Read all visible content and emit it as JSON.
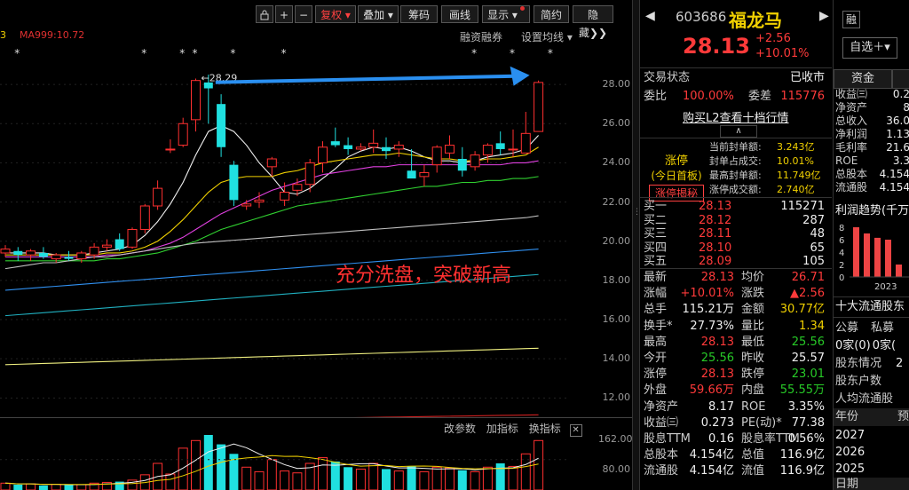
{
  "toolbar": {
    "ma_prefix": "3",
    "ma_label": "MA999:10.72",
    "buttons": {
      "fuquan": "复权",
      "diejia": "叠加",
      "choumao": "筹码",
      "huaxian": "画线",
      "xianshi": "显示",
      "jianyue": "简约",
      "yincang": "隐藏"
    },
    "rongzi": "融资融券",
    "junxian": "设置均线"
  },
  "chart_data": {
    "type": "candlestick",
    "ylim": [
      11.2,
      29.5
    ],
    "yticks": [
      "28.00",
      "26.00",
      "24.00",
      "22.00",
      "20.00",
      "18.00",
      "16.00",
      "14.00",
      "12.00"
    ],
    "candles": [
      [
        19.4,
        19.8,
        19.2,
        19.6
      ],
      [
        19.5,
        19.7,
        19.0,
        19.3
      ],
      [
        19.3,
        19.6,
        19.0,
        19.5
      ],
      [
        19.4,
        19.7,
        19.1,
        19.2
      ],
      [
        19.1,
        19.4,
        18.9,
        19.3
      ],
      [
        19.2,
        19.5,
        19.0,
        19.1
      ],
      [
        19.1,
        19.5,
        18.9,
        19.4
      ],
      [
        19.3,
        19.9,
        19.1,
        19.7
      ],
      [
        19.7,
        20.1,
        19.5,
        19.8
      ],
      [
        20.1,
        20.4,
        19.5,
        19.6
      ],
      [
        19.7,
        20.7,
        19.6,
        20.6
      ],
      [
        20.6,
        21.9,
        20.4,
        21.8
      ],
      [
        21.8,
        23.1,
        21.6,
        22.7
      ],
      [
        24.7,
        25.2,
        24.5,
        24.7
      ],
      [
        24.9,
        26.3,
        24.8,
        26.0
      ],
      [
        26.2,
        28.3,
        25.6,
        28.2
      ],
      [
        28.1,
        28.5,
        26.0,
        27.8
      ],
      [
        27.0,
        27.5,
        24.3,
        24.8
      ],
      [
        23.9,
        24.1,
        21.8,
        22.1
      ],
      [
        21.8,
        22.1,
        21.6,
        21.9
      ],
      [
        22.0,
        22.5,
        21.7,
        22.1
      ],
      [
        23.8,
        24.3,
        23.3,
        24.2
      ],
      [
        22.1,
        23.0,
        21.8,
        22.5
      ],
      [
        22.6,
        23.2,
        22.3,
        22.9
      ],
      [
        22.9,
        24.2,
        22.5,
        24.0
      ],
      [
        24.0,
        25.1,
        23.5,
        24.8
      ],
      [
        25.1,
        25.8,
        24.8,
        24.9
      ],
      [
        24.9,
        25.3,
        24.4,
        24.7
      ],
      [
        24.7,
        25.0,
        24.6,
        24.8
      ],
      [
        24.8,
        25.7,
        24.5,
        25.0
      ],
      [
        24.8,
        25.3,
        24.2,
        24.6
      ],
      [
        24.7,
        25.1,
        24.3,
        24.9
      ],
      [
        23.6,
        24.7,
        23.3,
        23.2
      ],
      [
        23.3,
        23.9,
        22.8,
        23.5
      ],
      [
        23.9,
        24.9,
        23.5,
        24.8
      ],
      [
        24.5,
        25.4,
        24.2,
        24.9
      ],
      [
        24.2,
        24.8,
        23.3,
        23.6
      ],
      [
        23.8,
        24.6,
        23.6,
        24.4
      ],
      [
        24.4,
        25.0,
        24.0,
        24.9
      ],
      [
        25.0,
        25.6,
        24.4,
        24.7
      ],
      [
        24.7,
        25.7,
        24.3,
        24.7
      ],
      [
        24.5,
        26.6,
        24.5,
        25.5
      ],
      [
        25.6,
        28.2,
        25.6,
        28.1
      ]
    ],
    "ma_series": [
      {
        "color": "#f0f0f0",
        "values": [
          19.4,
          19.4,
          19.4,
          19.4,
          19.3,
          19.3,
          19.3,
          19.4,
          19.5,
          19.6,
          19.8,
          20.3,
          21.0,
          21.9,
          23.0,
          24.4,
          25.6,
          25.9,
          25.6,
          24.9,
          24.0,
          23.3,
          22.5,
          22.4,
          22.7,
          23.2,
          23.7,
          24.3,
          24.6,
          24.8,
          24.7,
          24.8,
          24.6,
          24.3,
          24.1,
          24.1,
          24.0,
          24.1,
          24.3,
          24.4,
          24.5,
          24.7,
          25.4
        ]
      },
      {
        "color": "#f0d000",
        "values": [
          19.3,
          19.3,
          19.3,
          19.3,
          19.3,
          19.3,
          19.3,
          19.3,
          19.4,
          19.4,
          19.5,
          19.7,
          20.0,
          20.5,
          21.1,
          21.8,
          22.5,
          23.0,
          23.2,
          23.3,
          23.3,
          23.3,
          23.5,
          23.6,
          23.8,
          24.0,
          24.1,
          24.2,
          24.3,
          24.4,
          24.4,
          24.5,
          24.4,
          24.3,
          24.2,
          24.2,
          24.1,
          24.1,
          24.2,
          24.2,
          24.3,
          24.4,
          24.8
        ]
      },
      {
        "color": "#e040e0",
        "values": [
          19.2,
          19.2,
          19.2,
          19.2,
          19.2,
          19.2,
          19.2,
          19.2,
          19.3,
          19.3,
          19.4,
          19.5,
          19.7,
          19.9,
          20.2,
          20.6,
          21.0,
          21.4,
          21.7,
          22.0,
          22.3,
          22.6,
          22.8,
          23.0,
          23.2,
          23.4,
          23.5,
          23.6,
          23.7,
          23.8,
          23.8,
          23.9,
          23.9,
          23.9,
          23.9,
          23.9,
          23.9,
          23.9,
          23.9,
          23.9,
          24.0,
          24.0,
          24.1
        ]
      },
      {
        "color": "#30d030",
        "values": [
          19.0,
          19.0,
          19.0,
          19.0,
          19.0,
          19.0,
          19.0,
          19.0,
          19.1,
          19.1,
          19.2,
          19.3,
          19.4,
          19.6,
          19.8,
          20.0,
          20.3,
          20.6,
          20.8,
          21.0,
          21.2,
          21.4,
          21.6,
          21.8,
          21.9,
          22.0,
          22.1,
          22.2,
          22.3,
          22.4,
          22.5,
          22.6,
          22.7,
          22.8,
          22.8,
          22.9,
          23.0,
          23.0,
          23.1,
          23.1,
          23.2,
          23.2,
          23.3
        ]
      },
      {
        "color": "#c0c0c0",
        "values": [
          18.6,
          18.7,
          18.8,
          18.9,
          18.9,
          19.0,
          19.1,
          19.2,
          19.2,
          19.3,
          19.4,
          19.5,
          19.6,
          19.7,
          19.8,
          19.9,
          19.95,
          20.0,
          20.05,
          20.1,
          20.15,
          20.2,
          20.25,
          20.3,
          20.35,
          20.4,
          20.45,
          20.5,
          20.55,
          20.6,
          20.65,
          20.7,
          20.75,
          20.8,
          20.85,
          20.9,
          20.95,
          21.0,
          21.05,
          21.1,
          21.15,
          21.2,
          21.3
        ]
      },
      {
        "color": "#3090f0",
        "values": [
          17.5,
          17.55,
          17.6,
          17.65,
          17.7,
          17.75,
          17.8,
          17.85,
          17.9,
          17.95,
          18.0,
          18.05,
          18.1,
          18.15,
          18.2,
          18.25,
          18.3,
          18.35,
          18.4,
          18.45,
          18.5,
          18.55,
          18.6,
          18.65,
          18.7,
          18.75,
          18.8,
          18.85,
          18.9,
          18.95,
          19.0,
          19.05,
          19.1,
          19.15,
          19.2,
          19.25,
          19.3,
          19.35,
          19.4,
          19.45,
          19.5,
          19.55,
          19.6
        ]
      },
      {
        "color": "#20b0c0",
        "values": [
          16.2,
          16.25,
          16.3,
          16.35,
          16.4,
          16.45,
          16.5,
          16.55,
          16.6,
          16.65,
          16.7,
          16.75,
          16.8,
          16.85,
          16.9,
          16.95,
          17.0,
          17.05,
          17.1,
          17.15,
          17.2,
          17.25,
          17.3,
          17.35,
          17.4,
          17.45,
          17.5,
          17.55,
          17.6,
          17.65,
          17.7,
          17.75,
          17.8,
          17.85,
          17.9,
          17.95,
          18.0,
          18.05,
          18.1,
          18.15,
          18.2,
          18.25,
          18.3
        ]
      },
      {
        "color": "#f0f080",
        "values": [
          13.7,
          13.72,
          13.74,
          13.76,
          13.78,
          13.8,
          13.82,
          13.84,
          13.86,
          13.88,
          13.9,
          13.92,
          13.94,
          13.96,
          13.98,
          14.0,
          14.02,
          14.04,
          14.06,
          14.08,
          14.1,
          14.12,
          14.14,
          14.16,
          14.18,
          14.2,
          14.22,
          14.24,
          14.26,
          14.28,
          14.3,
          14.32,
          14.34,
          14.36,
          14.38,
          14.4,
          14.42,
          14.44,
          14.46,
          14.48,
          14.5,
          14.52,
          14.54
        ]
      },
      {
        "color": "#d02020",
        "values": [
          10.72,
          10.73,
          10.74,
          10.75,
          10.76,
          10.77,
          10.78,
          10.79,
          10.8,
          10.81,
          10.82,
          10.83,
          10.84,
          10.85,
          10.86,
          10.87,
          10.88,
          10.89,
          10.9,
          10.91,
          10.92,
          10.93,
          10.94,
          10.95,
          10.96,
          10.97,
          10.98,
          10.99,
          11.0,
          11.01,
          11.02,
          11.03,
          11.04,
          11.05,
          11.06,
          11.07,
          11.08,
          11.09,
          11.1,
          11.11,
          11.12,
          11.13,
          11.14
        ]
      }
    ],
    "high_marker": "28.29",
    "annotation": "充分洗盘，突破新高",
    "volume": {
      "ylim": [
        0,
        175
      ],
      "yticks": [
        "162.00",
        "80.00"
      ],
      "bars": [
        18,
        14,
        16,
        12,
        15,
        13,
        14,
        18,
        20,
        22,
        26,
        40,
        70,
        42,
        110,
        130,
        150,
        120,
        95,
        60,
        48,
        80,
        50,
        45,
        70,
        85,
        75,
        60,
        55,
        70,
        55,
        50,
        62,
        48,
        60,
        58,
        52,
        48,
        60,
        70,
        62,
        95,
        130
      ],
      "tools": [
        "改参数",
        "加指标",
        "换指标"
      ]
    }
  },
  "quote": {
    "code": "603686",
    "name": "福龙马",
    "rong": "融",
    "price": "28.13",
    "change": "+2.56",
    "pct": "+10.01%",
    "zixuan": "自选",
    "trade_status_label": "交易状态",
    "trade_status": "已收市",
    "weibi_label": "委比",
    "weibi": "100.00%",
    "weicha_label": "委差",
    "weicha": "115776",
    "l2": "购买L2查看十档行情",
    "zt_title": "涨停",
    "zt_sub": "(今日首板)",
    "zt_btn": "涨停揭秘",
    "seal": [
      {
        "label": "当前封单额:",
        "value": "3.243亿"
      },
      {
        "label": "封单占成交:",
        "value": "10.01%"
      },
      {
        "label": "最高封单额:",
        "value": "11.749亿"
      },
      {
        "label": "涨停成交额:",
        "value": "2.740亿"
      }
    ],
    "book": [
      {
        "label": "买一",
        "price": "28.13",
        "vol": "115271"
      },
      {
        "label": "买二",
        "price": "28.12",
        "vol": "287"
      },
      {
        "label": "买三",
        "price": "28.11",
        "vol": "48"
      },
      {
        "label": "买四",
        "price": "28.10",
        "vol": "65"
      },
      {
        "label": "买五",
        "price": "28.09",
        "vol": "105"
      }
    ],
    "stats": [
      {
        "l1": "最新",
        "v1": "28.13",
        "c1": "red",
        "l2": "均价",
        "v2": "26.71",
        "c2": "red"
      },
      {
        "l1": "涨幅",
        "v1": "+10.01%",
        "c1": "red",
        "l2": "涨跌",
        "v2": "▲2.56",
        "c2": "red"
      },
      {
        "l1": "总手",
        "v1": "115.21万",
        "c1": "white",
        "l2": "金额",
        "v2": "30.77亿",
        "c2": "yellow"
      },
      {
        "l1": "换手*",
        "v1": "27.73%",
        "c1": "white",
        "l2": "量比",
        "v2": "1.34",
        "c2": "yellow"
      },
      {
        "l1": "最高",
        "v1": "28.13",
        "c1": "red",
        "l2": "最低",
        "v2": "25.56",
        "c2": "green"
      },
      {
        "l1": "今开",
        "v1": "25.56",
        "c1": "green",
        "l2": "昨收",
        "v2": "25.57",
        "c2": "white"
      },
      {
        "l1": "涨停",
        "v1": "28.13",
        "c1": "red",
        "l2": "跌停",
        "v2": "23.01",
        "c2": "green"
      },
      {
        "l1": "外盘",
        "v1": "59.66万",
        "c1": "red",
        "l2": "内盘",
        "v2": "55.55万",
        "c2": "green"
      },
      {
        "l1": "净资产",
        "v1": "8.17",
        "c1": "white",
        "l2": "ROE",
        "v2": "3.35%",
        "c2": "white"
      },
      {
        "l1": "收益㈢",
        "v1": "0.273",
        "c1": "white",
        "l2": "PE(动)*",
        "v2": "77.38",
        "c2": "white"
      },
      {
        "l1": "股息TTM",
        "v1": "0.16",
        "c1": "white",
        "l2": "股息率TTM",
        "v2": "0.56%",
        "c2": "white"
      },
      {
        "l1": "总股本",
        "v1": "4.154亿",
        "c1": "white",
        "l2": "总值",
        "v2": "116.9亿",
        "c2": "white"
      },
      {
        "l1": "流通股",
        "v1": "4.154亿",
        "c1": "white",
        "l2": "流值",
        "v2": "116.9亿",
        "c2": "white"
      }
    ]
  },
  "fin": {
    "tabs": [
      "资金",
      ""
    ],
    "rows": [
      {
        "l": "收益㈢",
        "v": "0.2"
      },
      {
        "l": "净资产",
        "v": "8"
      },
      {
        "l": "总收入",
        "v": "36.0"
      },
      {
        "l": "净利润",
        "v": "1.13"
      },
      {
        "l": "毛利率",
        "v": "21.6"
      },
      {
        "l": "ROE",
        "v": "3.3"
      },
      {
        "l": "总股本",
        "v": "4.154"
      },
      {
        "l": "流通股",
        "v": "4.154"
      }
    ],
    "trend_title": "利润趋势(千万)",
    "trend_ticks": [
      "8",
      "6",
      "4",
      "2",
      "0"
    ],
    "trend_bars": [
      9,
      7.0,
      6.3,
      6.0,
      2.0
    ],
    "trend_year": "2023",
    "holders": "十大流通股东",
    "gongmu": "公募",
    "simu": "私募",
    "jia0": "0家(0)",
    "jia1": "0家(",
    "gudong": "股东情况",
    "gudong_v": "2",
    "hushu": "股东户数",
    "renjun": "人均流通股",
    "nianfen": "年份",
    "yu": "预",
    "years": [
      "2027",
      "2026",
      "2025"
    ],
    "riqi": "日期"
  }
}
